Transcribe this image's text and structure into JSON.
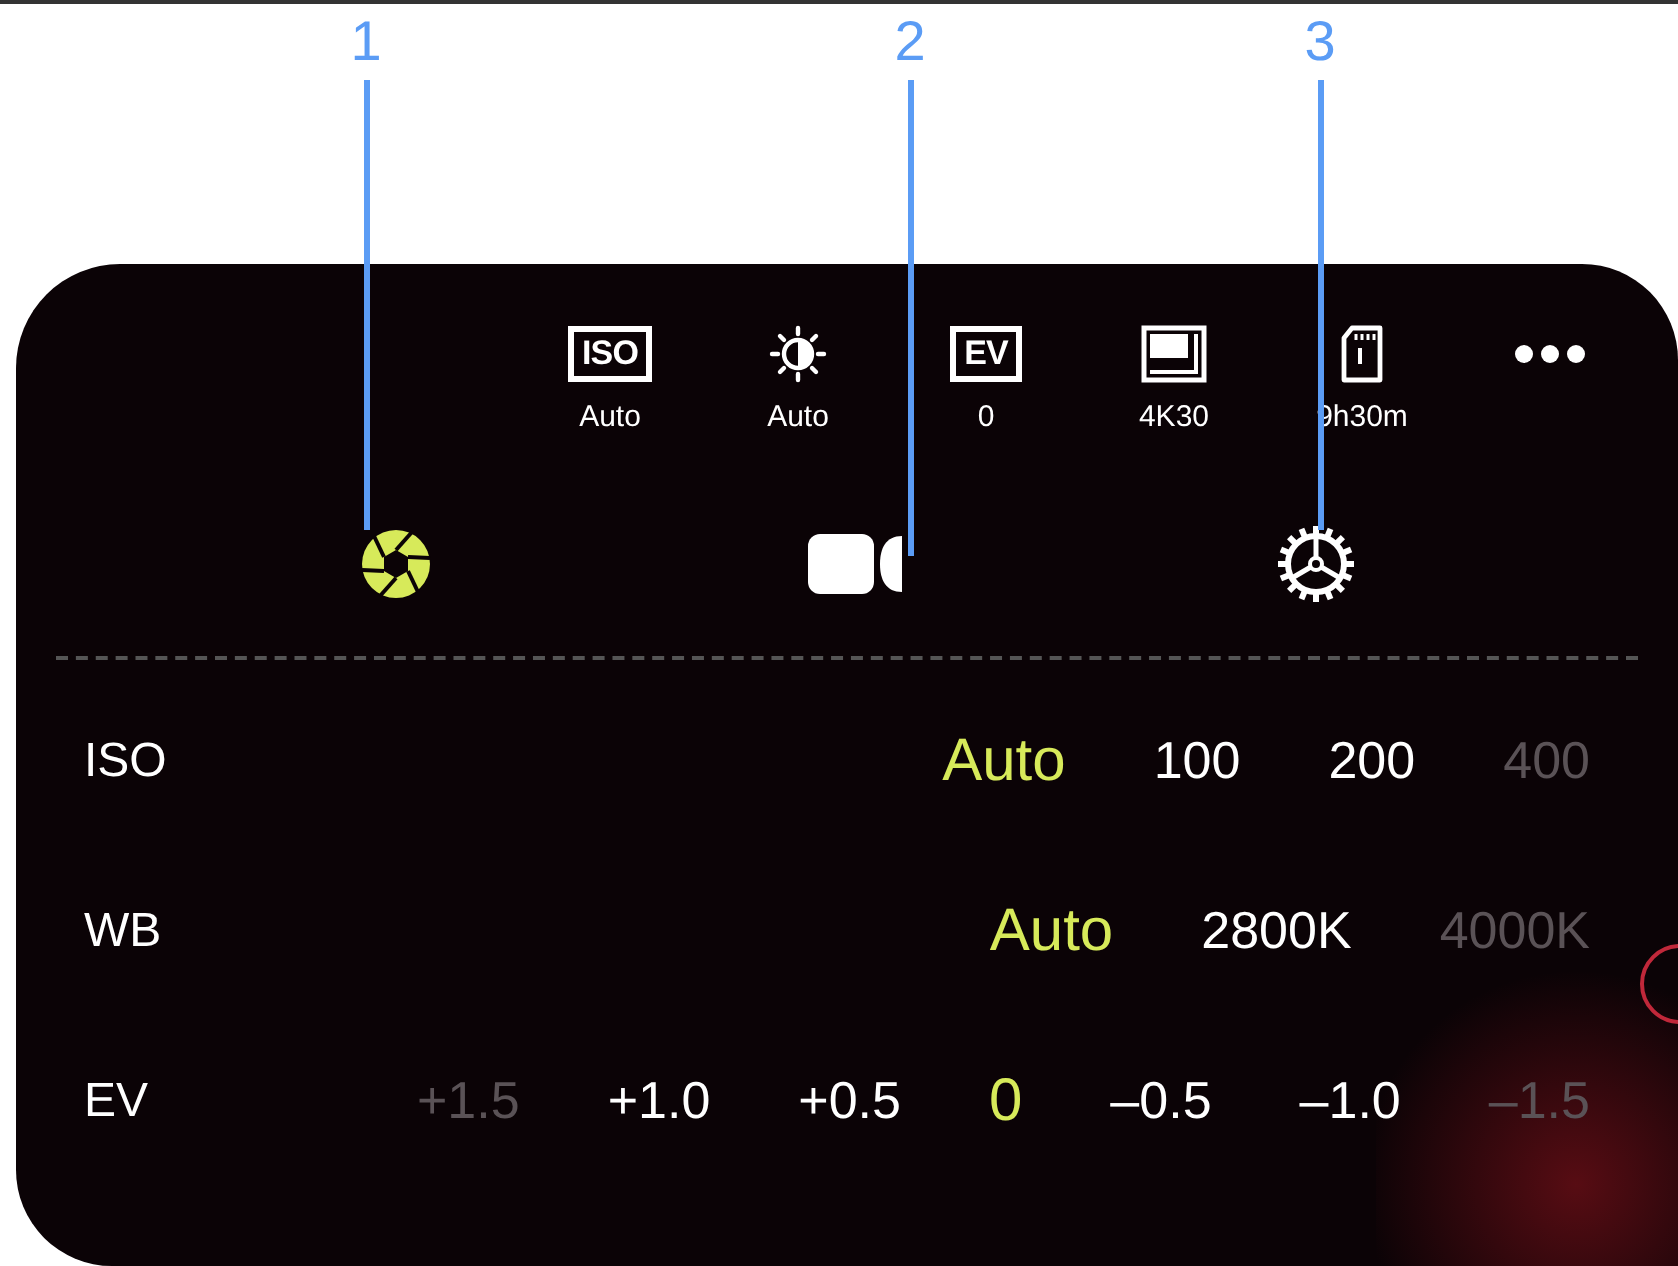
{
  "callouts": [
    {
      "number": "1"
    },
    {
      "number": "2"
    },
    {
      "number": "3"
    }
  ],
  "status_items": [
    {
      "kind": "iso",
      "badge": "ISO",
      "value": "Auto"
    },
    {
      "kind": "brightness",
      "value": "Auto"
    },
    {
      "kind": "ev",
      "badge": "EV",
      "value": "0"
    },
    {
      "kind": "resolution",
      "value": "4K30"
    },
    {
      "kind": "storage",
      "value": "9h30m"
    },
    {
      "kind": "more"
    }
  ],
  "mode_tabs": [
    {
      "kind": "photo",
      "selected": true
    },
    {
      "kind": "video",
      "selected": false
    },
    {
      "kind": "settings",
      "selected": false
    }
  ],
  "settings": [
    {
      "label": "ISO",
      "options": [
        {
          "text": "Auto",
          "selected": true,
          "dimmed": false
        },
        {
          "text": "100",
          "selected": false,
          "dimmed": false
        },
        {
          "text": "200",
          "selected": false,
          "dimmed": false
        },
        {
          "text": "400",
          "selected": false,
          "dimmed": true
        }
      ]
    },
    {
      "label": "WB",
      "options": [
        {
          "text": "Auto",
          "selected": true,
          "dimmed": false
        },
        {
          "text": "2800K",
          "selected": false,
          "dimmed": false
        },
        {
          "text": "4000K",
          "selected": false,
          "dimmed": true
        }
      ]
    },
    {
      "label": "EV",
      "options": [
        {
          "text": "+1.5",
          "selected": false,
          "dimmed": true
        },
        {
          "text": "+1.0",
          "selected": false,
          "dimmed": false
        },
        {
          "text": "+0.5",
          "selected": false,
          "dimmed": false
        },
        {
          "text": "0",
          "selected": true,
          "dimmed": false
        },
        {
          "text": "–0.5",
          "selected": false,
          "dimmed": false
        },
        {
          "text": "–1.0",
          "selected": false,
          "dimmed": false
        },
        {
          "text": "–1.5",
          "selected": false,
          "dimmed": true
        }
      ]
    }
  ]
}
